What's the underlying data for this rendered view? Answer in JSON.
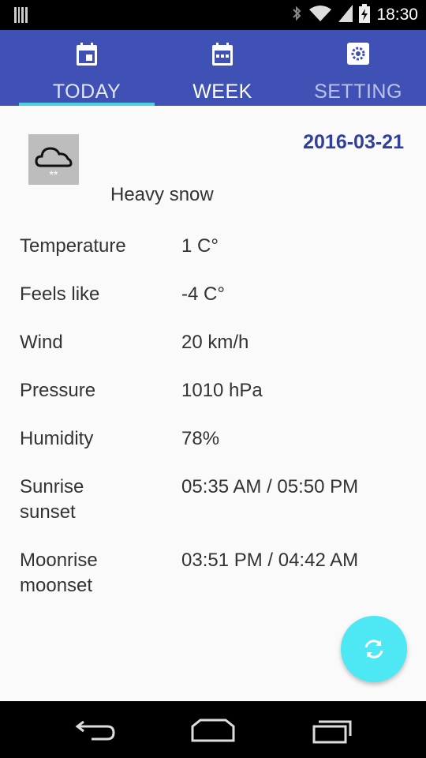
{
  "status_bar": {
    "time": "18:30",
    "icons": [
      "notification-barcode-icon",
      "bluetooth-icon",
      "wifi-icon",
      "cell-signal-icon",
      "battery-icon"
    ]
  },
  "tabs": [
    {
      "label": "TODAY",
      "icon": "calendar-today-icon",
      "active": true
    },
    {
      "label": "WEEK",
      "icon": "calendar-week-icon",
      "active": false
    },
    {
      "label": "SETTING",
      "icon": "settings-icon",
      "active": false
    }
  ],
  "today": {
    "date": "2016-03-21",
    "condition": "Heavy snow",
    "condition_icon": "snow-cloud-icon",
    "rows": [
      {
        "label": "Temperature",
        "value": "1 C°"
      },
      {
        "label": "Feels like",
        "value": "-4 C°"
      },
      {
        "label": "Wind",
        "value": "20 km/h"
      },
      {
        "label": "Pressure",
        "value": "1010 hPa"
      },
      {
        "label": "Humidity",
        "value": "78%"
      },
      {
        "label": "Sunrise\nsunset",
        "value": "05:35 AM / 05:50 PM"
      },
      {
        "label": "Moonrise\nmoonset",
        "value": "03:51 PM / 04:42 AM"
      }
    ]
  },
  "fab": {
    "icon": "refresh-icon"
  },
  "nav": {
    "icons": [
      "back-icon",
      "home-icon",
      "recent-apps-icon"
    ]
  },
  "colors": {
    "primary": "#3f51b5",
    "accent": "#4de8f4",
    "tab_indicator": "#4dd0e1",
    "date": "#303f9f"
  }
}
